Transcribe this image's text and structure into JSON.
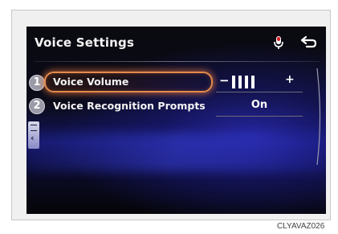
{
  "screen": {
    "title": "Voice Settings",
    "icons": {
      "microphone": "microphone-icon",
      "back": "back-arrow-icon"
    }
  },
  "settings": [
    {
      "number": "1",
      "label": "Voice Volume",
      "control": "volume-stepper",
      "minus_label": "−",
      "plus_label": "+",
      "volume_level": 4,
      "selected": true
    },
    {
      "number": "2",
      "label": "Voice Recognition Prompts",
      "value": "On"
    }
  ],
  "side_tab": {
    "icon": "menu-chevron-left-icon",
    "glyph": "‹"
  },
  "image_code": "CLYAVAZ026",
  "colors": {
    "highlight": "#e38a4c",
    "background_blue": "#141660",
    "text": "#f2f2f2"
  }
}
